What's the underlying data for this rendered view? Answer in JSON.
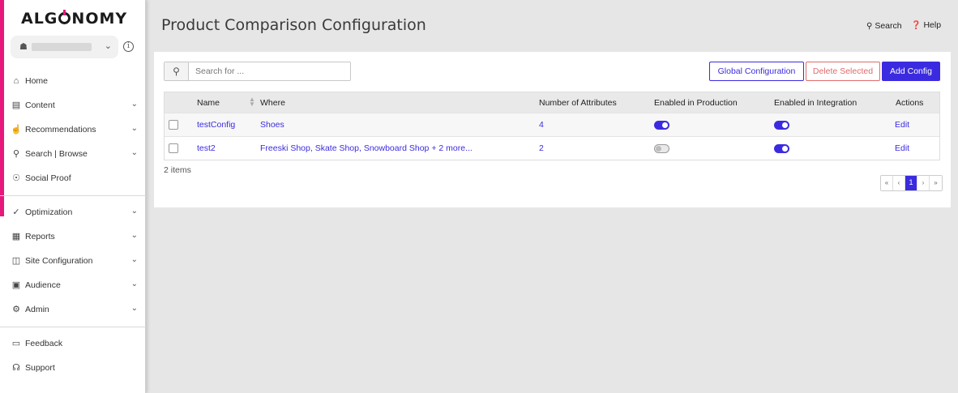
{
  "brand": {
    "logo_text_1": "ALG",
    "logo_text_2": "NOMY",
    "accent": "#e6187c",
    "primary": "#3b2be0"
  },
  "site_selector": {
    "icon": "storefront-icon",
    "chevron": "chevron-down-icon"
  },
  "nav": {
    "home": "Home",
    "content": "Content",
    "recommendations": "Recommendations",
    "search_browse": "Search | Browse",
    "social_proof": "Social Proof",
    "optimization": "Optimization",
    "reports": "Reports",
    "site_configuration": "Site Configuration",
    "audience": "Audience",
    "admin": "Admin",
    "feedback": "Feedback",
    "support": "Support"
  },
  "header": {
    "title": "Product Comparison Configuration",
    "search_label": "Search",
    "help_label": "Help"
  },
  "toolbar": {
    "search_placeholder": "Search for ...",
    "global_config_label": "Global Configuration",
    "delete_selected_label": "Delete Selected",
    "add_config_label": "Add Config"
  },
  "table": {
    "columns": {
      "name": "Name",
      "where": "Where",
      "attributes": "Number of Attributes",
      "production": "Enabled in Production",
      "integration": "Enabled in Integration",
      "actions": "Actions"
    },
    "rows": [
      {
        "name": "testConfig",
        "where": "Shoes",
        "where_more": "",
        "attributes": "4",
        "production": true,
        "integration": true,
        "action": "Edit"
      },
      {
        "name": "test2",
        "where": "Freeski Shop, Skate Shop, Snowboard Shop",
        "where_more": "+ 2 more...",
        "attributes": "2",
        "production": false,
        "integration": true,
        "action": "Edit"
      }
    ],
    "items_count": "2 items"
  },
  "pagination": {
    "first": "«",
    "prev": "‹",
    "current": "1",
    "next": "›",
    "last": "»"
  }
}
